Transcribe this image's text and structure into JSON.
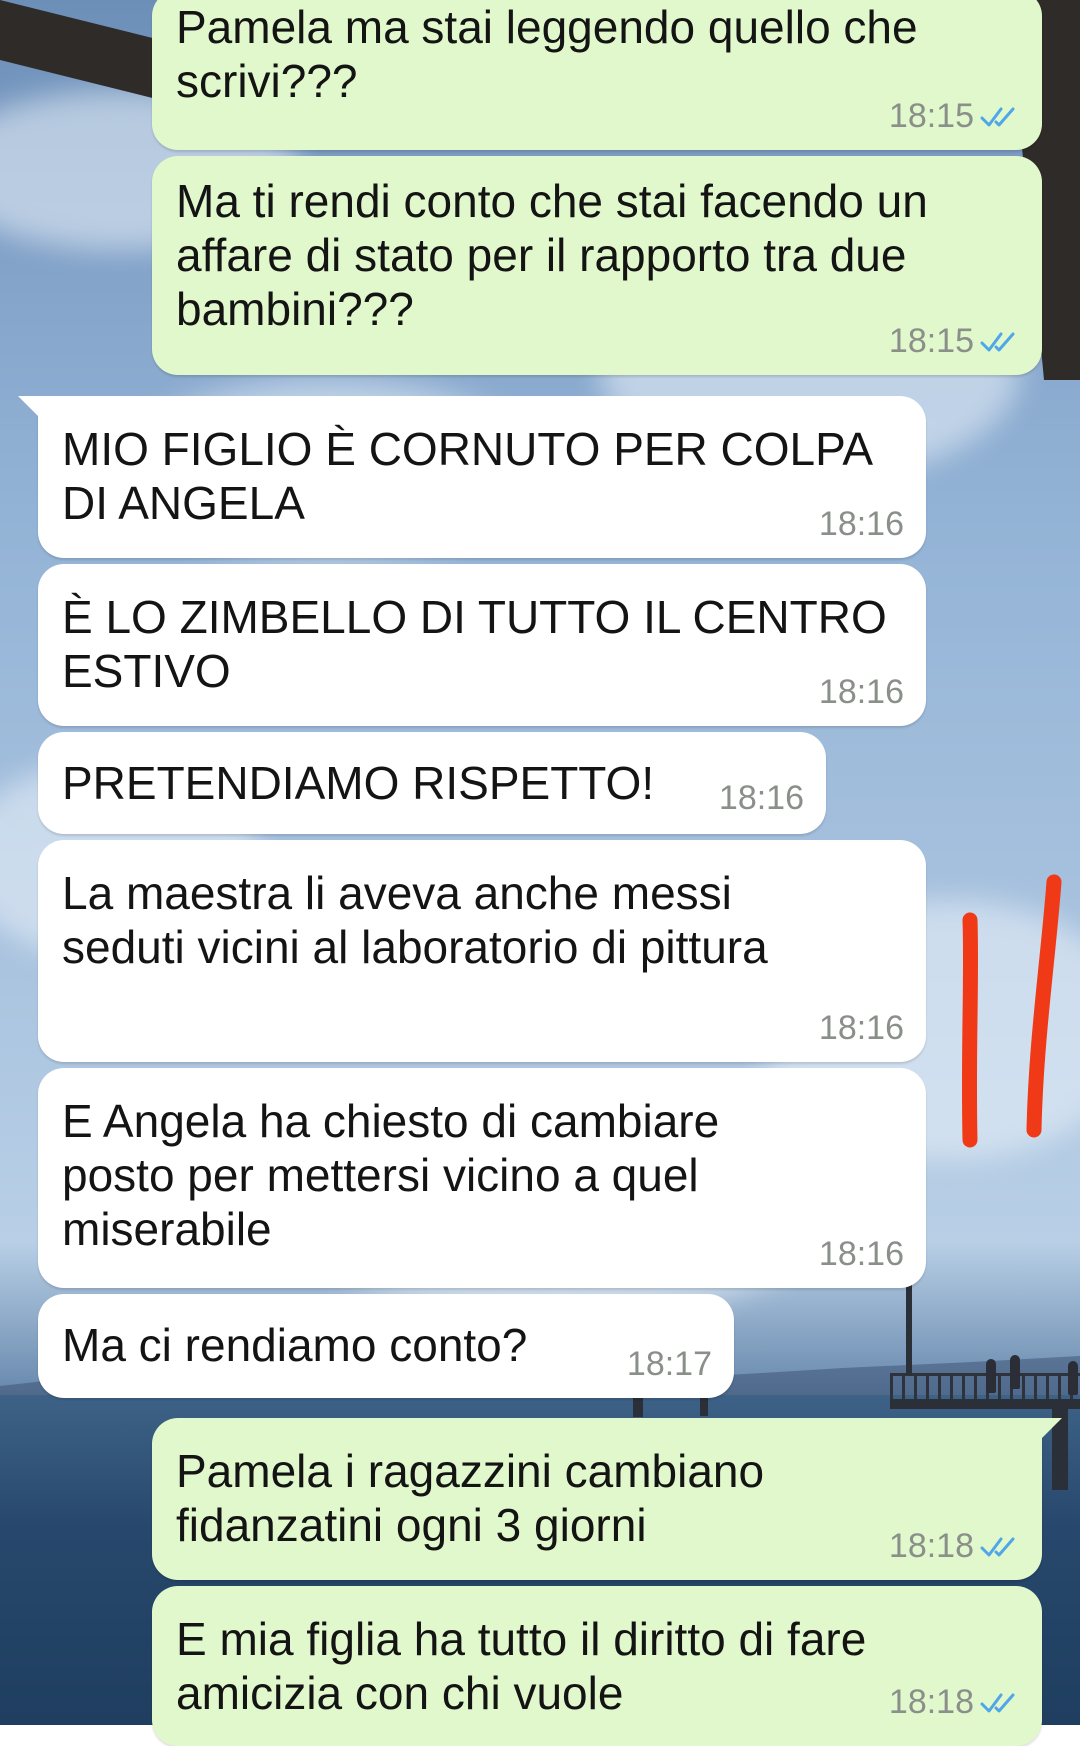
{
  "colors": {
    "outgoing_bubble": "#e1f8cc",
    "incoming_bubble": "#ffffff",
    "read_receipt": "#4fa6e8",
    "timestamp": "#8a8f8a",
    "annotation_marks": "#f03a17"
  },
  "messages": [
    {
      "direction": "outgoing",
      "text": "Pamela ma stai leggendo quello che\nscrivi???",
      "time": "18:15",
      "status": "read"
    },
    {
      "direction": "outgoing",
      "text": "Ma ti rendi conto che stai facendo un\naffare di stato per il rapporto tra due\nbambini???",
      "time": "18:15",
      "status": "read"
    },
    {
      "direction": "incoming",
      "text": "MIO FIGLIO È CORNUTO PER COLPA\nDI ANGELA",
      "time": "18:16"
    },
    {
      "direction": "incoming",
      "text": "È LO ZIMBELLO DI TUTTO IL CENTRO\nESTIVO",
      "time": "18:16"
    },
    {
      "direction": "incoming",
      "text": "PRETENDIAMO RISPETTO!",
      "time": "18:16"
    },
    {
      "direction": "incoming",
      "text": "La maestra li aveva anche messi\nseduti vicini al laboratorio di pittura",
      "time": "18:16"
    },
    {
      "direction": "incoming",
      "text": "E Angela ha chiesto di cambiare\nposto per mettersi vicino a quel\nmiserabile",
      "time": "18:16"
    },
    {
      "direction": "incoming",
      "text": "Ma ci rendiamo conto?",
      "time": "18:17"
    },
    {
      "direction": "outgoing",
      "text": "Pamela i ragazzini cambiano\nfidanzatini ogni 3 giorni",
      "time": "18:18",
      "status": "read"
    },
    {
      "direction": "outgoing",
      "text": "E mia figlia ha tutto il diritto di fare\namicizia con chi vuole",
      "time": "18:18",
      "status": "read"
    }
  ],
  "annotation": {
    "icon": "red-double-line-marks"
  }
}
